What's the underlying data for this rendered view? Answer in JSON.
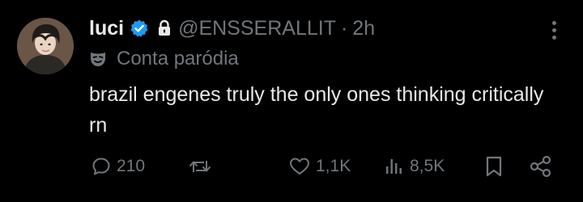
{
  "author": {
    "display_name": "luci",
    "handle": "@ENSSERALLIT",
    "separator": "·",
    "timestamp": "2h",
    "badge_label": "Conta paródia"
  },
  "tweet": {
    "text": "brazil engenes truly the only ones thinking critically rn"
  },
  "actions": {
    "replies": "210",
    "likes": "1,1K",
    "views": "8,5K"
  },
  "colors": {
    "background": "#000000",
    "primary_text": "#e7e9ea",
    "secondary_text": "#71767b",
    "verified_blue": "#1d9bf0"
  },
  "icons": [
    "verified-badge-icon",
    "lock-icon",
    "more-icon",
    "parody-mask-icon",
    "reply-icon",
    "retweet-icon",
    "like-icon",
    "views-icon",
    "bookmark-icon",
    "share-icon"
  ]
}
